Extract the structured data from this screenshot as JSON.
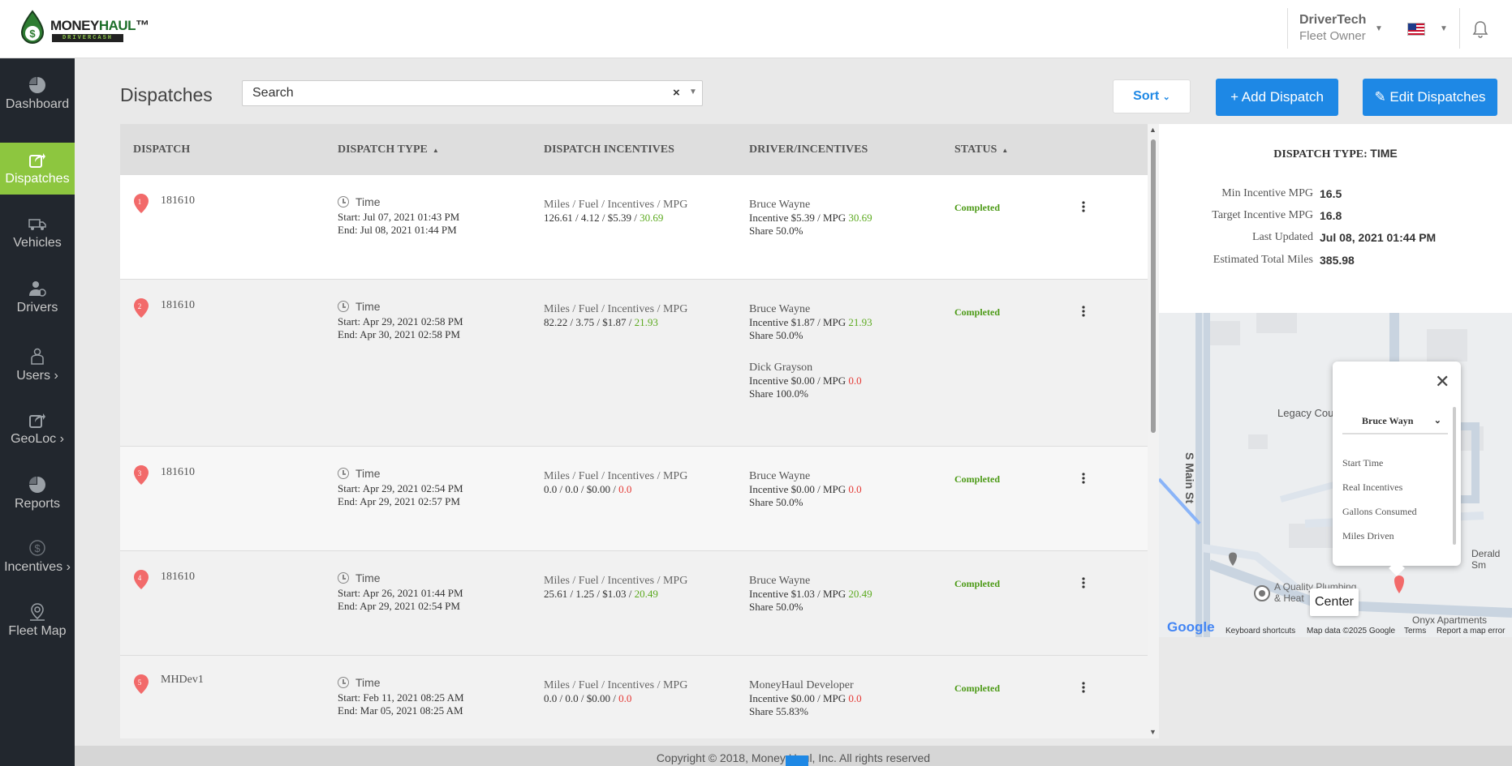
{
  "header": {
    "logo_main": "MONEY",
    "logo_accent": "HAUL",
    "logo_tm": "™",
    "logo_sub": "DRIVERCASH",
    "user_name": "DriverTech",
    "user_role": "Fleet Owner"
  },
  "sidebar": {
    "items": [
      {
        "label": "Dashboard",
        "icon": "pie-chart-icon"
      },
      {
        "label": "Dispatches",
        "icon": "share-icon"
      },
      {
        "label": "Vehicles",
        "icon": "truck-icon"
      },
      {
        "label": "Drivers",
        "icon": "driver-icon"
      },
      {
        "label": "Users",
        "icon": "users-icon"
      },
      {
        "label": "GeoLoc",
        "icon": "share-icon"
      },
      {
        "label": "Reports",
        "icon": "pie-chart-icon"
      },
      {
        "label": "Incentives",
        "icon": "dollar-icon"
      },
      {
        "label": "Fleet Map",
        "icon": "map-pin-icon"
      }
    ],
    "chevron": "›",
    "active": "Dispatches"
  },
  "page": {
    "title": "Dispatches",
    "search_placeholder": "Search",
    "search_clear": "×",
    "sort_label": "Sort",
    "add_label": "+ Add Dispatch",
    "edit_label": "✎ Edit Dispatches"
  },
  "table": {
    "headers": {
      "dispatch": "DISPATCH",
      "type": "DISPATCH TYPE",
      "incentives": "DISPATCH INCENTIVES",
      "driver": "DRIVER/INCENTIVES",
      "status": "STATUS"
    },
    "rows": [
      {
        "num": "1",
        "id": "181610",
        "type": "Time",
        "start": "Start: Jul 07, 2021 01:43 PM",
        "end": "End: Jul 08, 2021 01:44 PM",
        "inc_head": "Miles / Fuel / Incentives / MPG",
        "inc_vals": "126.61 / 4.12 / $5.39 / ",
        "inc_mpg": "30.69",
        "d1_name": "Bruce Wayne",
        "d1_inc": "Incentive $5.39 / MPG ",
        "d1_mpg": "30.69",
        "d1_share": "Share 50.0%",
        "status": "Completed"
      },
      {
        "num": "2",
        "id": "181610",
        "type": "Time",
        "start": "Start: Apr 29, 2021 02:58 PM",
        "end": "End: Apr 30, 2021 02:58 PM",
        "inc_head": "Miles / Fuel / Incentives / MPG",
        "inc_vals": "82.22 / 3.75 / $1.87 / ",
        "inc_mpg": "21.93",
        "d1_name": "Bruce Wayne",
        "d1_inc": "Incentive $1.87 / MPG ",
        "d1_mpg": "21.93",
        "d1_share": "Share 50.0%",
        "d2_name": "Dick Grayson",
        "d2_inc": "Incentive $0.00 / MPG ",
        "d2_mpg": "0.0",
        "d2_share": "Share 100.0%",
        "status": "Completed"
      },
      {
        "num": "3",
        "id": "181610",
        "type": "Time",
        "start": "Start: Apr 29, 2021 02:54 PM",
        "end": "End: Apr 29, 2021 02:57 PM",
        "inc_head": "Miles / Fuel / Incentives / MPG",
        "inc_vals": "0.0 / 0.0 / $0.00 / ",
        "inc_mpg": "0.0",
        "d1_name": "Bruce Wayne",
        "d1_inc": "Incentive $0.00 / MPG ",
        "d1_mpg": "0.0",
        "d1_share": "Share 50.0%",
        "status": "Completed"
      },
      {
        "num": "4",
        "id": "181610",
        "type": "Time",
        "start": "Start: Apr 26, 2021 01:44 PM",
        "end": "End: Apr 29, 2021 02:54 PM",
        "inc_head": "Miles / Fuel / Incentives / MPG",
        "inc_vals": "25.61 / 1.25 / $1.03 / ",
        "inc_mpg": "20.49",
        "d1_name": "Bruce Wayne",
        "d1_inc": "Incentive $1.03 / MPG ",
        "d1_mpg": "20.49",
        "d1_share": "Share 50.0%",
        "status": "Completed"
      },
      {
        "num": "5",
        "id": "MHDev1",
        "type": "Time",
        "start": "Start: Feb 11, 2021 08:25 AM",
        "end": "End: Mar 05, 2021 08:25 AM",
        "inc_head": "Miles / Fuel / Incentives / MPG",
        "inc_vals": "0.0 / 0.0 / $0.00 / ",
        "inc_mpg": "0.0",
        "d1_name": "MoneyHaul Developer",
        "d1_inc": "Incentive $0.00 / MPG ",
        "d1_mpg": "0.0",
        "d1_share": "Share 55.83%",
        "status": "Completed"
      }
    ]
  },
  "info": {
    "title": "DISPATCH TYPE: ",
    "title_value": "TIME",
    "rows": [
      {
        "label": "Min Incentive MPG",
        "value": "16.5"
      },
      {
        "label": "Target Incentive MPG",
        "value": "16.8"
      },
      {
        "label": "Last Updated",
        "value": "Jul 08, 2021 01:44 PM"
      },
      {
        "label": "Estimated Total Miles",
        "value": "385.98"
      }
    ]
  },
  "map": {
    "street": "S Main St",
    "place1": "Legacy Cou",
    "place2": "A Quality Plumbing",
    "place2b": "& Heat",
    "place3": "Onyx Apartments",
    "place4": "Derald Sm",
    "popup": {
      "close": "✕",
      "driver_select": "Bruce Wayn",
      "items": [
        "Start Time",
        "Real Incentives",
        "Gallons Consumed",
        "Miles Driven"
      ]
    },
    "center_btn": "Center",
    "footer": {
      "google": "Google",
      "shortcuts": "Keyboard shortcuts",
      "mapdata": "Map data ©2025 Google",
      "terms": "Terms",
      "report": "Report a map error"
    },
    "colors": {
      "pin": "#f26a6a",
      "road": "#c9d4e0",
      "water": "#8ab4f8"
    }
  },
  "footer": {
    "text": "Copyright © 2018, Money Haul, Inc. All rights reserved"
  },
  "colors": {
    "sidebar_bg": "#22272e",
    "active_green": "#8dc63f",
    "primary_blue": "#1e88e5",
    "status_green": "#4c9a16",
    "mpg_green": "#5caa1f",
    "mpg_red": "#e53935"
  }
}
